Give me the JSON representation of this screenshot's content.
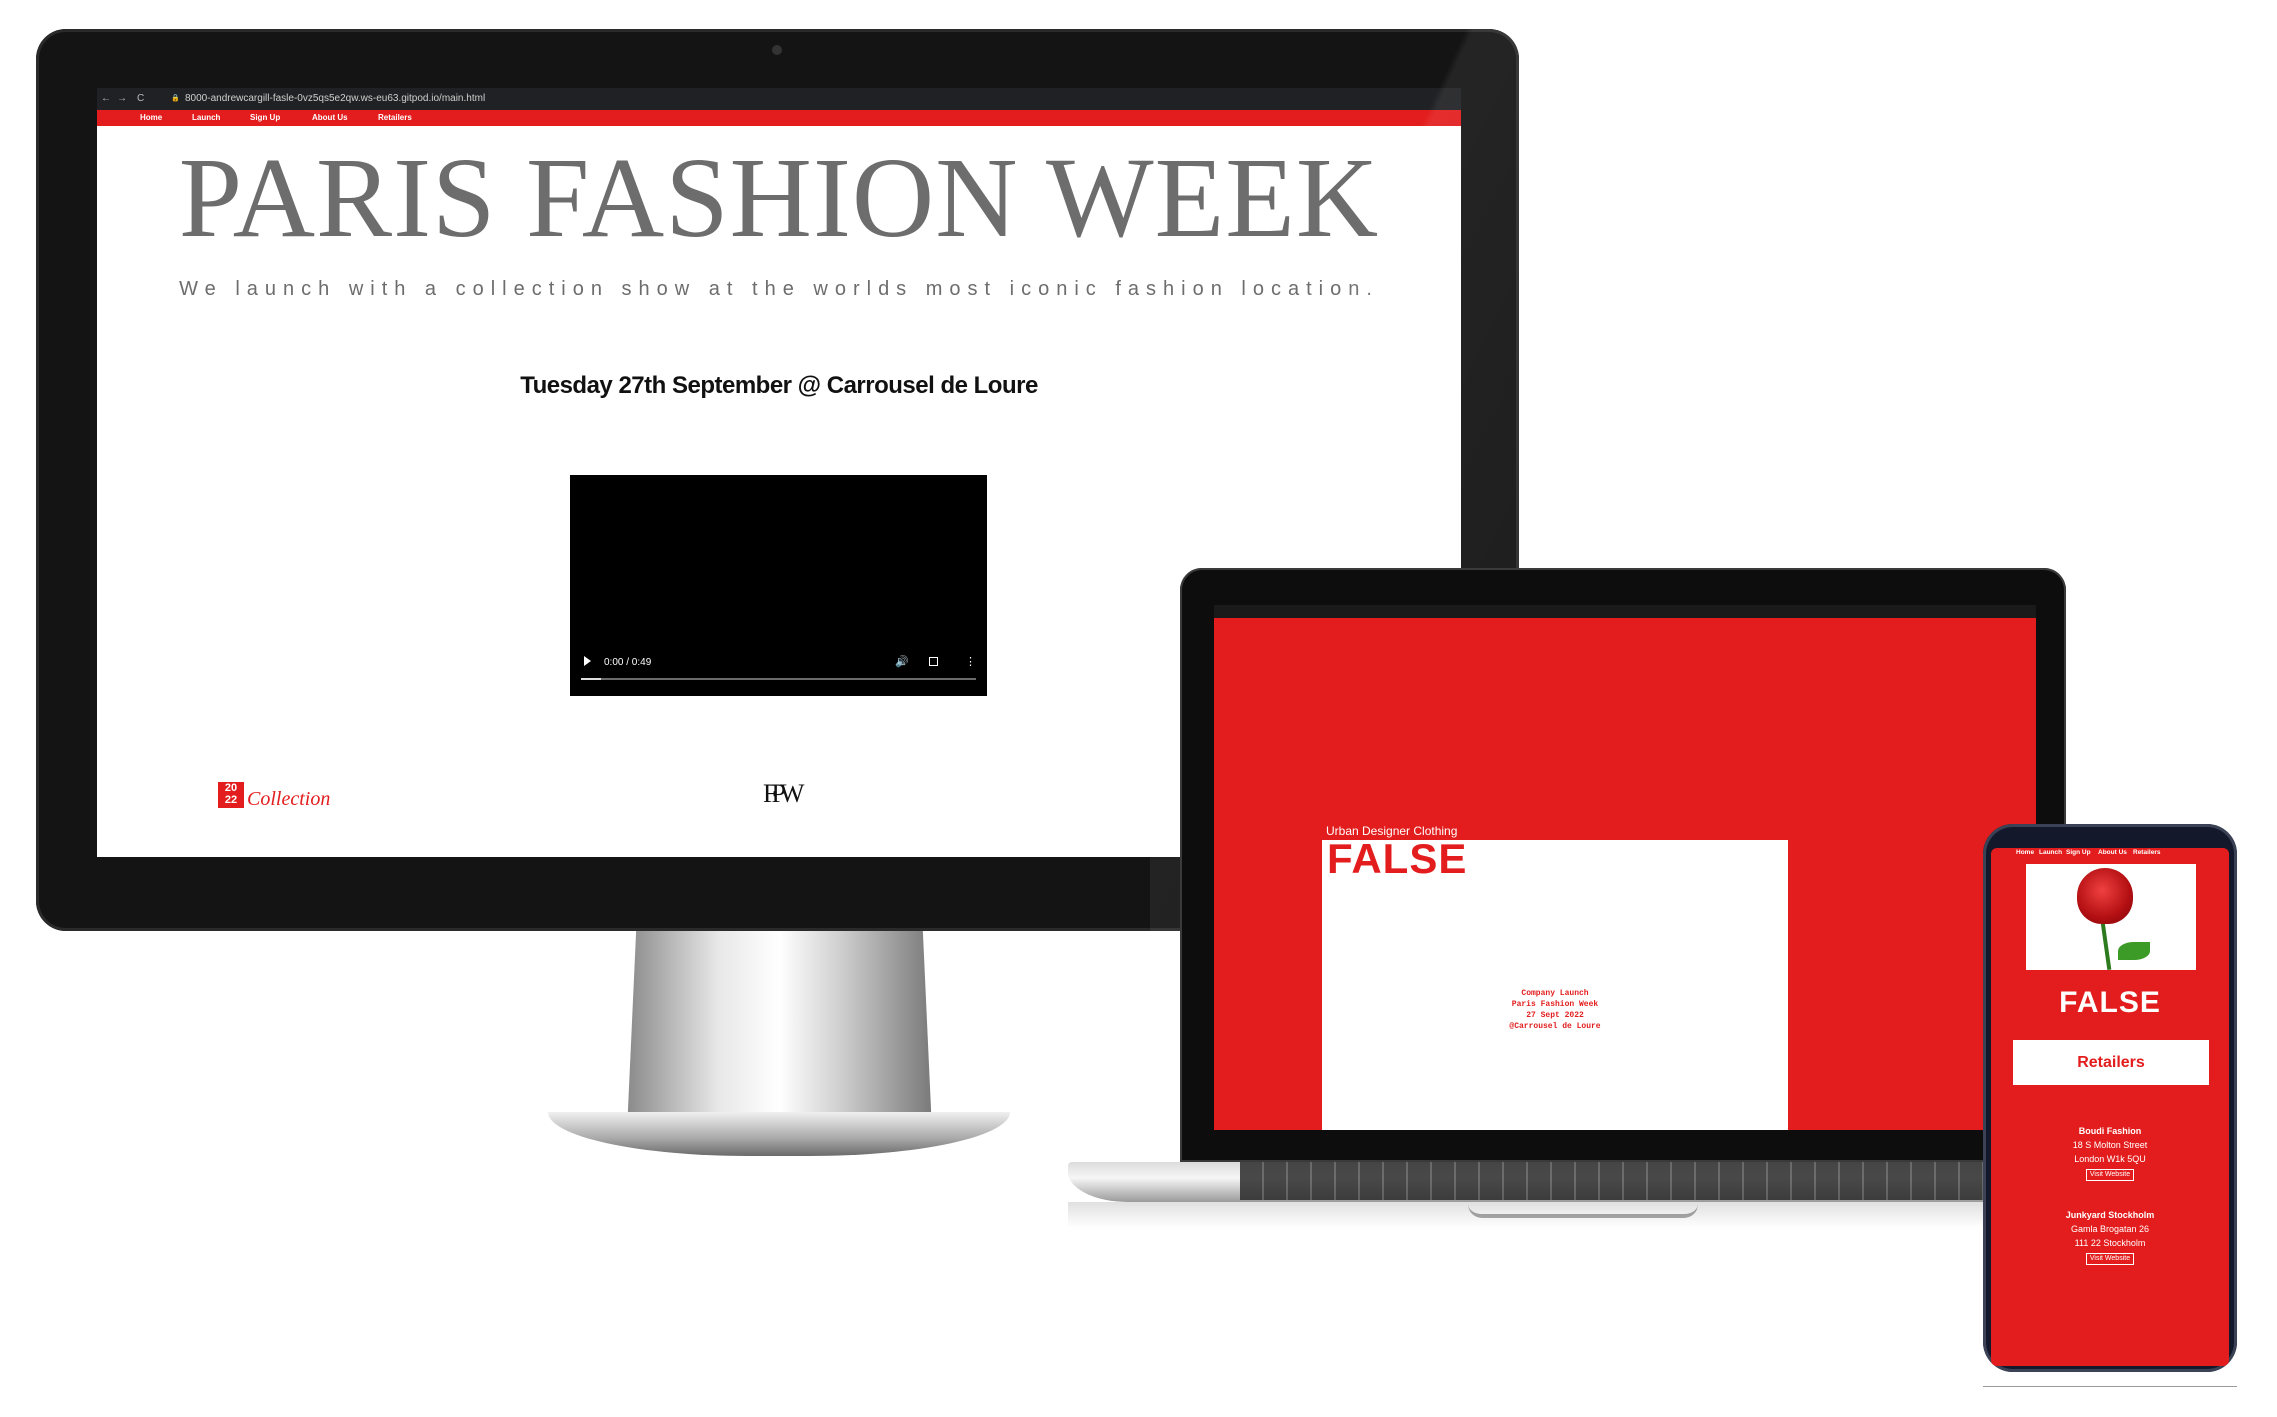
{
  "desktop": {
    "browser": {
      "url": "8000-andrewcargill-fasle-0vz5qs5e2qw.ws-eu63.gitpod.io/main.html",
      "back_glyph": "←",
      "forward_glyph": "→",
      "reload_glyph": "C",
      "lock_glyph": "🔒"
    },
    "nav": [
      "Home",
      "Launch",
      "Sign Up",
      "About Us",
      "Retailers"
    ],
    "hero_title": "PARIS FASHION WEEK",
    "hero_subtitle": "We launch with a collection show at the worlds most iconic fashion location.",
    "event_line": "Tuesday 27th September @ Carrousel de Loure",
    "video": {
      "time": "0:00 / 0:49",
      "progress": 0.05
    },
    "logos": {
      "year_top": "20",
      "year_bottom": "22",
      "collection": "Collection",
      "fpw": "FPW"
    }
  },
  "laptop": {
    "tagline": "Urban Designer Clothing",
    "brand": "FALSE",
    "details": [
      "Company Launch",
      "Paris Fashion Week",
      "27 Sept 2022",
      "@Carrousel de Loure"
    ]
  },
  "phone": {
    "nav": [
      "Home",
      "Launch",
      "Sign Up",
      "About Us",
      "Retailers"
    ],
    "brand": "FALSE",
    "section_title": "Retailers",
    "stores": [
      {
        "name": "Boudi Fashion",
        "line1": "18 S Molton Street",
        "line2": "London W1k 5QU",
        "link": "Visit Website"
      },
      {
        "name": "Junkyard Stockholm",
        "line1": "Gamla Brogatan 26",
        "line2": "111 22 Stockholm",
        "link": "Visit Website"
      }
    ]
  },
  "colors": {
    "brand_red": "#e31d1d",
    "title_gray": "#6d6d6d"
  },
  "icons": [
    "play-icon",
    "volume-icon",
    "fullscreen-icon",
    "more-menu-icon",
    "lock-icon",
    "rose-image"
  ]
}
